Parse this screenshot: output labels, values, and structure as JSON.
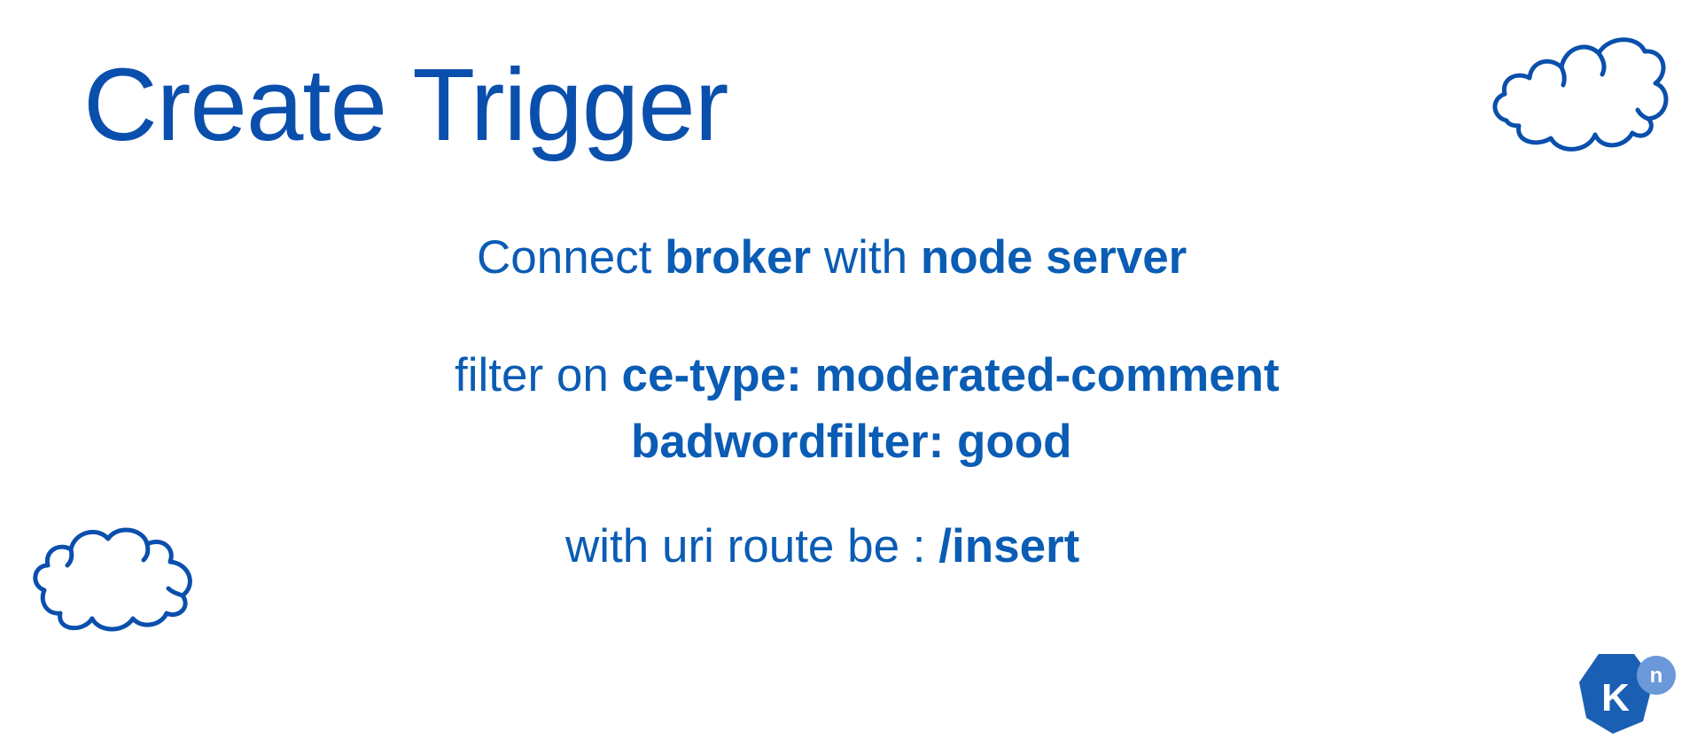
{
  "slide": {
    "title": "Create Trigger",
    "connect": {
      "prefix": "Connect",
      "subject": "broker",
      "middle": "with",
      "target": "node server"
    },
    "filter": {
      "prefix": "filter on",
      "attribute1": "ce-type: moderated-comment",
      "attribute2": "badwordfilter: good"
    },
    "uri": {
      "prefix": "with uri route be :",
      "route": "/insert"
    }
  },
  "logo": {
    "letter": "K",
    "superscript": "n"
  },
  "colors": {
    "title": "#0b4fad",
    "text": "#0a5cb4",
    "logo_primary": "#1a5fb4",
    "logo_badge": "#6a98d8"
  },
  "icons": [
    "cloud-icon",
    "cloud-icon",
    "knative-logo-icon"
  ]
}
